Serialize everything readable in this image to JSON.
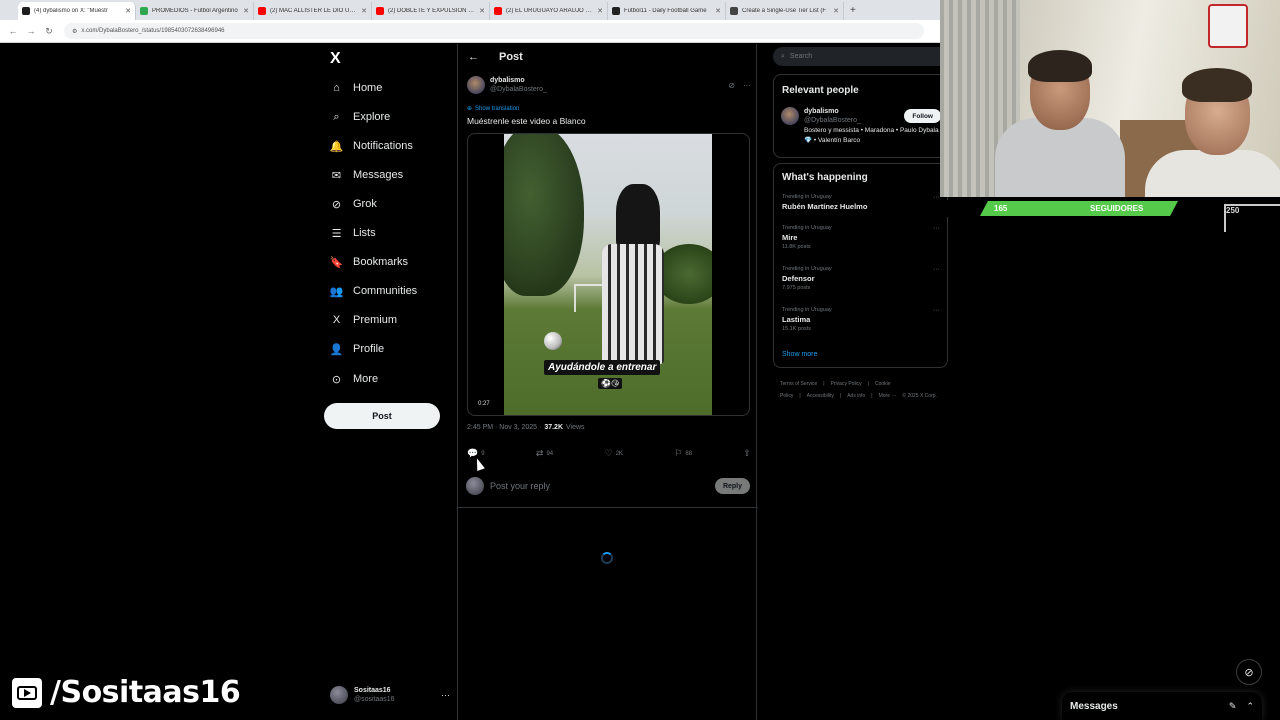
{
  "browser": {
    "tabs": [
      {
        "title": "(4) dybalismo on X: \"Muéstr",
        "color": "#1d1d1d",
        "active": true
      },
      {
        "title": "PROMEDIOS - Futbol Argentino",
        "color": "#2fa84f",
        "active": false
      },
      {
        "title": "(2) MAC ALLISTER LE DIO UN T",
        "color": "#ff0000",
        "active": false
      },
      {
        "title": "(2) DOBLETE Y EXPULSIÓN DE J",
        "color": "#ff0000",
        "active": false
      },
      {
        "title": "(2) EL URUGUAYO ARAÚJO RES",
        "color": "#ff0000",
        "active": false
      },
      {
        "title": "Futbol11 - Daily Football Game",
        "color": "#222222",
        "active": false
      },
      {
        "title": "Create a Single-Use Tier List (F",
        "color": "#444444",
        "active": false
      }
    ],
    "new_tab": "+",
    "url": "x.com/DybalaBostero_/status/1985403072638496946"
  },
  "leftnav": {
    "logo": "X",
    "items": [
      {
        "label": "Home",
        "icon": "home-icon",
        "glyph": "⌂"
      },
      {
        "label": "Explore",
        "icon": "search-icon",
        "glyph": "⌕"
      },
      {
        "label": "Notifications",
        "icon": "bell-icon",
        "glyph": "🔔"
      },
      {
        "label": "Messages",
        "icon": "mail-icon",
        "glyph": "✉"
      },
      {
        "label": "Grok",
        "icon": "grok-icon",
        "glyph": "⊘"
      },
      {
        "label": "Lists",
        "icon": "list-icon",
        "glyph": "☰"
      },
      {
        "label": "Bookmarks",
        "icon": "bookmark-icon",
        "glyph": "🔖"
      },
      {
        "label": "Communities",
        "icon": "communities-icon",
        "glyph": "👥"
      },
      {
        "label": "Premium",
        "icon": "x-premium-icon",
        "glyph": "X"
      },
      {
        "label": "Profile",
        "icon": "profile-icon",
        "glyph": "👤"
      },
      {
        "label": "More",
        "icon": "more-circle-icon",
        "glyph": "⊙"
      }
    ],
    "post_button": "Post",
    "account": {
      "name": "Sositaas16",
      "handle": "@sositaas16",
      "more": "···"
    }
  },
  "main": {
    "header_title": "Post",
    "back_glyph": "←",
    "author": {
      "name": "dybalismo",
      "handle": "@DybalaBostero_"
    },
    "show_translation": "Show translation",
    "text": "Muéstrenle este video a Blanco",
    "video": {
      "caption": "Ayudándole a entrenar",
      "emojis": "⚽😘",
      "timecode": "0:27"
    },
    "meta": {
      "time": "2:45 PM · Nov 3, 2025 ·",
      "views": "37.2K",
      "views_label": "Views"
    },
    "actions": {
      "replies": "9",
      "reposts": "94",
      "likes": "2K",
      "bookmarks": "88"
    },
    "reply_placeholder": "Post your reply",
    "reply_button": "Reply"
  },
  "right": {
    "search_placeholder": "Search",
    "relevant": {
      "title": "Relevant people",
      "person": {
        "name": "dybalismo",
        "handle": "@DybalaBostero_",
        "follow": "Follow",
        "bio": "Bostero y messista • Maradona • Paulo Dybala💎 • Valentín Barco"
      }
    },
    "happening": {
      "title": "What's happening",
      "trends": [
        {
          "context": "Trending in Uruguay",
          "name": "Rubén Martínez Huelmo",
          "count": ""
        },
        {
          "context": "Trending in Uruguay",
          "name": "Mire",
          "count": "11.8K posts"
        },
        {
          "context": "Trending in Uruguay",
          "name": "Defensor",
          "count": "7,975 posts"
        },
        {
          "context": "Trending in Uruguay",
          "name": "Lastima",
          "count": "15.1K posts"
        }
      ],
      "show_more": "Show more"
    },
    "footer": [
      "Terms of Service",
      "|",
      "Privacy Policy",
      "|",
      "Cookie Policy",
      "|",
      "Accessibility",
      "|",
      "Ads info",
      "|",
      "More ···",
      "© 2025 X Corp."
    ]
  },
  "stream": {
    "followers_current": "165",
    "followers_label": "SEGUIDORES",
    "followers_goal": "250",
    "followers_progress": 0.66,
    "watermark": "/Sositaas16"
  },
  "messages_drawer": {
    "title": "Messages"
  }
}
